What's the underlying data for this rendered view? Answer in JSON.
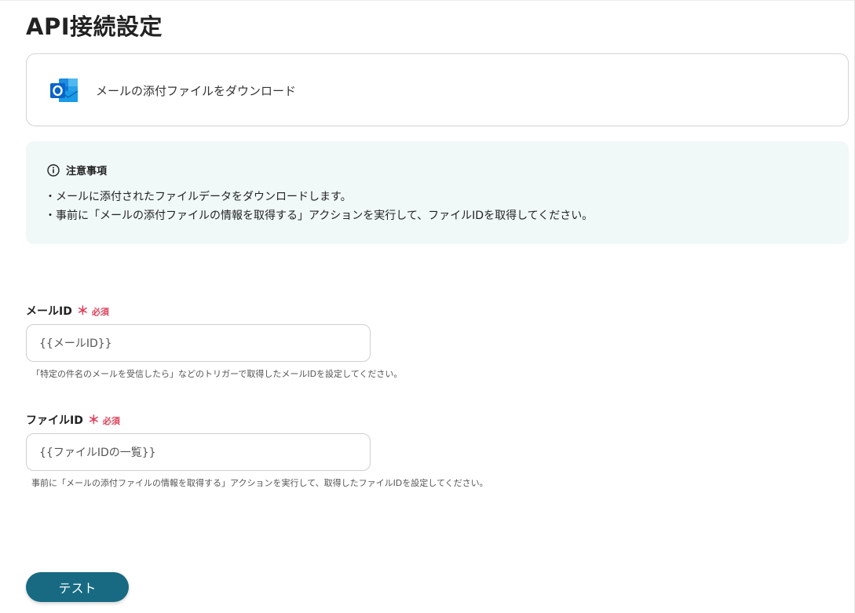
{
  "page": {
    "title": "API接続設定"
  },
  "app_card": {
    "icon": "outlook-icon",
    "action_label": "メールの添付ファイルをダウンロード"
  },
  "notice": {
    "icon": "info-icon",
    "title": "注意事項",
    "lines": [
      "・メールに添付されたファイルデータをダウンロードします。",
      "・事前に「メールの添付ファイルの情報を取得する」アクションを実行して、ファイルIDを取得してください。"
    ]
  },
  "fields": [
    {
      "label": "メールID",
      "required_mark": "＊",
      "required_text": "必須",
      "value": "{{メールID}}",
      "help": "「特定の件名のメールを受信したら」などのトリガーで取得したメールIDを設定してください。"
    },
    {
      "label": "ファイルID",
      "required_mark": "＊",
      "required_text": "必須",
      "value": "{{ファイルIDの一覧}}",
      "help": "事前に「メールの添付ファイルの情報を取得する」アクションを実行して、取得したファイルIDを設定してください。"
    }
  ],
  "actions": {
    "test_label": "テスト"
  },
  "colors": {
    "accent": "#176a82",
    "required": "#e0405a",
    "notice_bg": "#f0f8f8",
    "outlook_blue": "#0a64c8"
  }
}
